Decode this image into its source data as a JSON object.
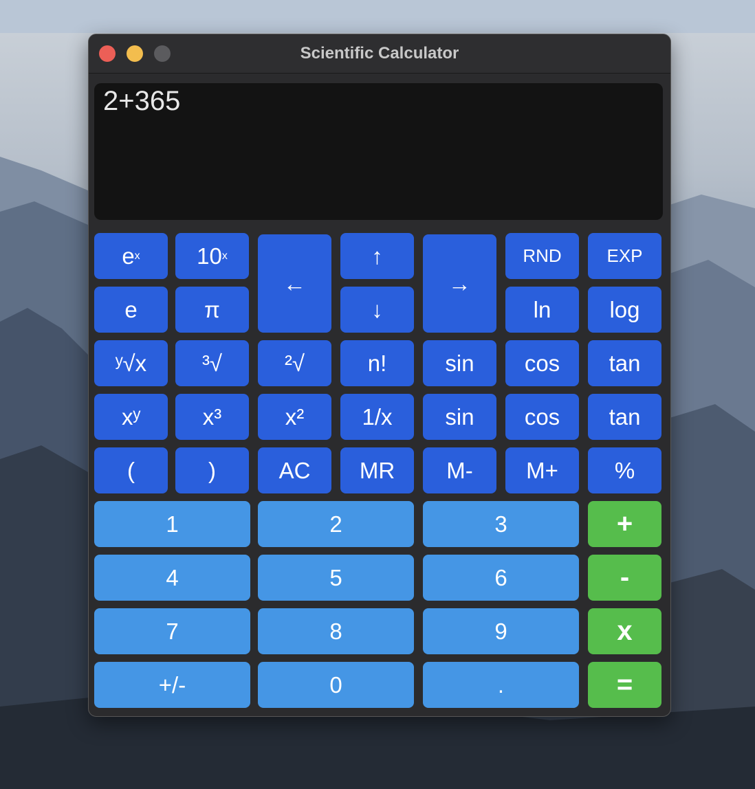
{
  "window": {
    "title": "Scientific Calculator"
  },
  "display": {
    "expression": "2+365"
  },
  "buttons": {
    "exp_x": "e",
    "exp_x_sup": "x",
    "ten_x": "10",
    "ten_x_sup": "x",
    "left": "←",
    "up": "↑",
    "right": "→",
    "rnd": "RND",
    "exp": "EXP",
    "e": "e",
    "pi": "π",
    "down": "↓",
    "ln": "ln",
    "log": "log",
    "yroot": "ʸ√x",
    "croot": "³√",
    "sqroot": "²√",
    "fact": "n!",
    "sin1": "sin",
    "cos1": "cos",
    "tan1": "tan",
    "xy": "xʸ",
    "x3": "x³",
    "x2": "x²",
    "inv": "1/x",
    "sin2": "sin",
    "cos2": "cos",
    "tan2": "tan",
    "lparen": "(",
    "rparen": ")",
    "ac": "AC",
    "mr": "MR",
    "mminus": "M-",
    "mplus": "M+",
    "percent": "%",
    "n1": "1",
    "n2": "2",
    "n3": "3",
    "plus": "+",
    "n4": "4",
    "n5": "5",
    "n6": "6",
    "minus": "-",
    "n7": "7",
    "n8": "8",
    "n9": "9",
    "times": "x",
    "sign": "+/-",
    "n0": "0",
    "dot": ".",
    "equals": "="
  },
  "colors": {
    "function_key": "#2a5fdc",
    "number_key": "#4596e5",
    "operator_key": "#56bd4c",
    "display_bg": "#131313",
    "close": "#ec5f57",
    "minimize": "#f3bd4e"
  }
}
